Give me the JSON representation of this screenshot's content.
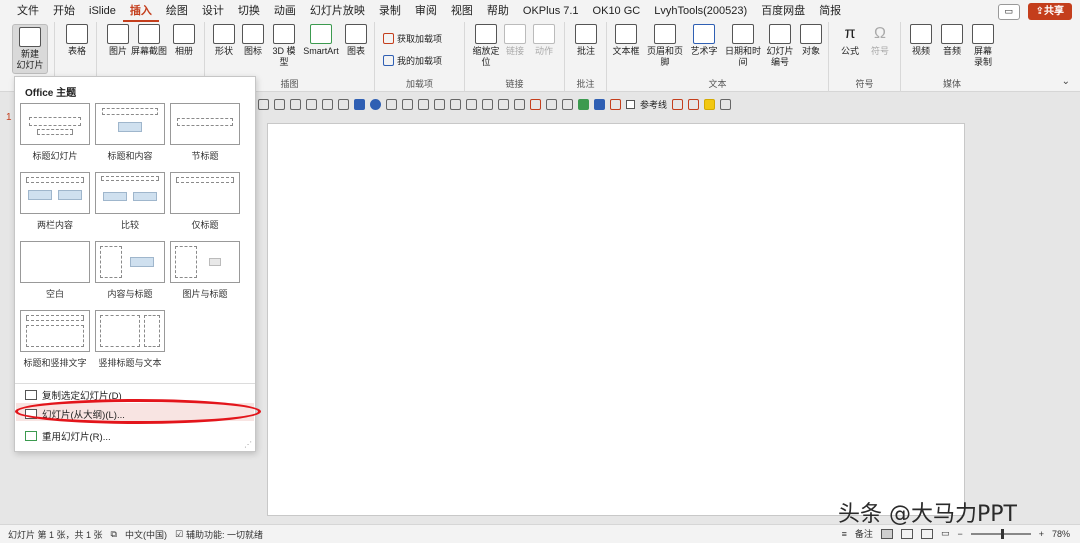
{
  "menu": {
    "tabs": [
      "文件",
      "开始",
      "iSlide",
      "插入",
      "绘图",
      "设计",
      "切换",
      "动画",
      "幻灯片放映",
      "录制",
      "审阅",
      "视图",
      "帮助",
      "OKPlus 7.1",
      "OK10 GC",
      "LvyhTools(200523)",
      "百度网盘",
      "简报"
    ],
    "active_tab": "插入",
    "share_label": "共享",
    "accent": "#c43e1c"
  },
  "ribbon": {
    "slides": {
      "new_slide": "新建\n幻灯片"
    },
    "tables": {
      "table": "表格"
    },
    "images": {
      "picture": "图片",
      "screenshot": "屏幕截图",
      "album": "相册"
    },
    "illustrations": {
      "label": "插图",
      "shapes": "形状",
      "icons": "图标",
      "model3d": "3D 模型",
      "smartart": "SmartArt",
      "chart": "图表"
    },
    "addins": {
      "label": "加载项",
      "get": "获取加载项",
      "mine": "我的加载项"
    },
    "links": {
      "label": "链接",
      "zoom": "缩放定位",
      "link": "链接",
      "action": "动作"
    },
    "comments": {
      "label": "批注",
      "comment": "批注"
    },
    "text": {
      "label": "文本",
      "textbox": "文本框",
      "header_footer": "页眉和页脚",
      "wordart": "艺术字",
      "datetime": "日期和时间",
      "slide_number": "幻灯片\n编号",
      "object": "对象"
    },
    "symbols": {
      "label": "符号",
      "equation": "公式",
      "symbol": "符号"
    },
    "media": {
      "label": "媒体",
      "video": "视频",
      "audio": "音频",
      "screen_record": "屏幕\n录制"
    }
  },
  "format_bar": {
    "guides_label": "参考线"
  },
  "gallery": {
    "section_title": "Office 主题",
    "layouts": [
      "标题幻灯片",
      "标题和内容",
      "节标题",
      "两栏内容",
      "比较",
      "仅标题",
      "空白",
      "内容与标题",
      "图片与标题",
      "标题和竖排文字",
      "竖排标题与文本"
    ]
  },
  "commands": {
    "duplicate": "复制选定幻灯片(D)",
    "from_outline": "幻灯片(从大纲)(L)...",
    "reuse": "重用幻灯片(R)..."
  },
  "slide_panel": {
    "first_number": "1"
  },
  "status": {
    "slide_info": "幻灯片 第 1 张，共 1 张",
    "language": "中文(中国)",
    "accessibility": "辅助功能: 一切就绪",
    "notes": "备注",
    "zoom": "78%"
  },
  "watermark": "头条 @大马力PPT"
}
